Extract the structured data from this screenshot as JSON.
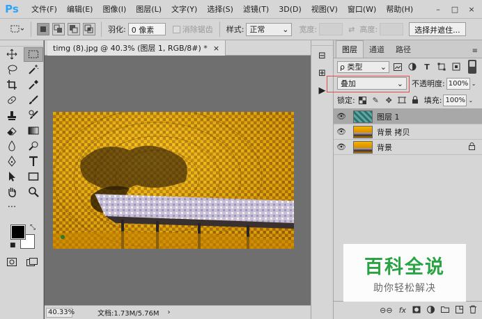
{
  "app": {
    "logo": "Ps"
  },
  "menu": [
    "文件(F)",
    "编辑(E)",
    "图像(I)",
    "图层(L)",
    "文字(Y)",
    "选择(S)",
    "滤镜(T)",
    "3D(D)",
    "视图(V)",
    "窗口(W)",
    "帮助(H)"
  ],
  "window_controls": {
    "minimize": "–",
    "maximize": "□",
    "close": "×"
  },
  "options": {
    "feather_label": "羽化:",
    "feather_value": "0 像素",
    "antialias_label": "消除锯齿",
    "style_label": "样式:",
    "style_value": "正常",
    "width_label": "宽度:",
    "height_label": "高度:",
    "select_mask_button": "选择并遮住..."
  },
  "document": {
    "tab_title": "timg (8).jpg @ 40.3% (图层 1, RGB/8#) *",
    "tab_close": "×",
    "zoom": "40.33%",
    "doc_info": "文档:1.73M/5.76M",
    "status_arrow": "›"
  },
  "dock": {
    "grip": "··",
    "buttons": [
      "⊟",
      "⊞",
      "▶"
    ]
  },
  "layers_panel": {
    "tabs": [
      "图层",
      "通道",
      "路径"
    ],
    "menu_icon": "≡",
    "filter_value": "ρ 类型",
    "blend_mode": "叠加",
    "opacity_label": "不透明度:",
    "opacity_value": "100%",
    "lock_label": "锁定:",
    "fill_label": "填充:",
    "fill_value": "100%",
    "layers": [
      {
        "name": "图层 1",
        "selected": true,
        "locked": false
      },
      {
        "name": "背景 拷贝",
        "selected": false,
        "locked": false
      },
      {
        "name": "背景",
        "selected": false,
        "locked": true
      }
    ],
    "bottom_icons": [
      "link-icon",
      "fx-icon",
      "mask-icon",
      "adjustment-icon",
      "folder-icon",
      "new-layer-icon",
      "trash-icon"
    ]
  },
  "watermark": {
    "title": "百科全说",
    "subtitle": "助你轻松解决"
  },
  "colors": {
    "accent": "#2aa345",
    "highlight": "#e24a4a",
    "selected_layer": "#a8a8a8"
  }
}
